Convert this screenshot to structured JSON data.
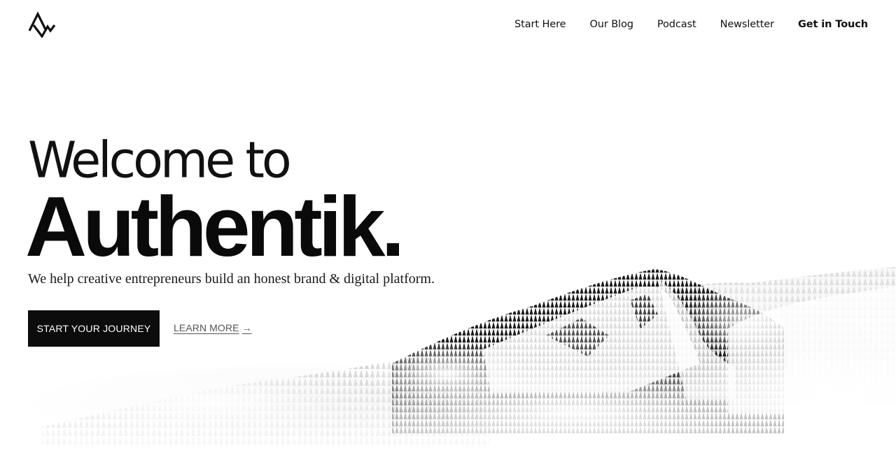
{
  "header": {
    "logo_alt": "Authentik mountain logo",
    "nav": [
      {
        "label": "Start Here"
      },
      {
        "label": "Our Blog"
      },
      {
        "label": "Podcast"
      },
      {
        "label": "Newsletter"
      },
      {
        "label": "Get in Touch"
      }
    ]
  },
  "hero": {
    "welcome": "Welcome to",
    "brand": "Authentik.",
    "tagline": "We help creative entrepreneurs build an honest brand & digital platform.",
    "primary_cta": "START YOUR JOURNEY",
    "secondary_cta": "LEARN MORE",
    "secondary_arrow": "→"
  },
  "image": {
    "subject": "mountain-in-mist",
    "palette": [
      "#ffffff",
      "#0a0a0a",
      "#555555"
    ]
  }
}
